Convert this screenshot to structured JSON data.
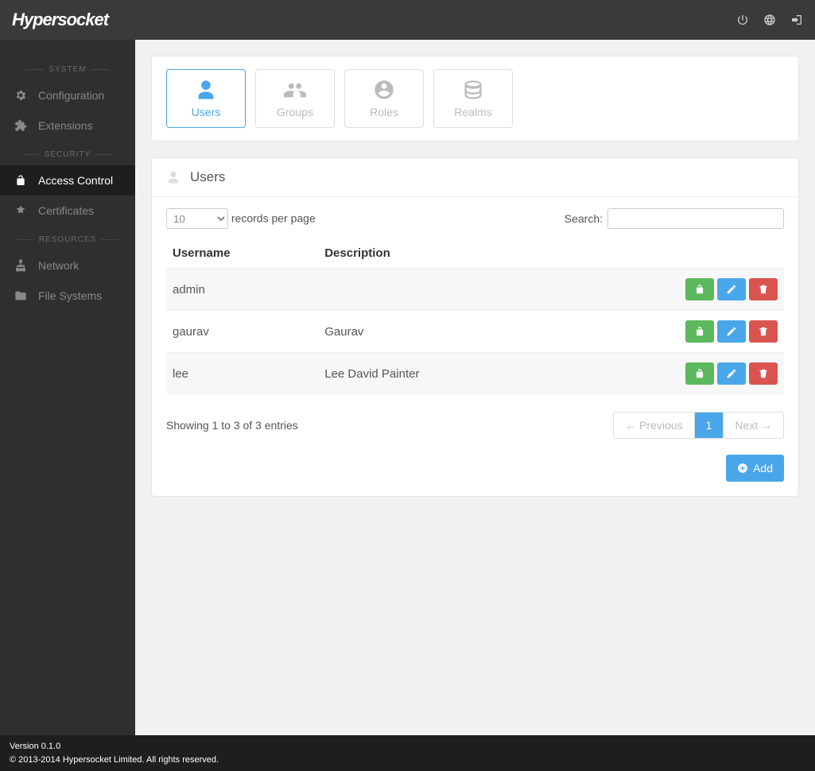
{
  "brand": "Hypersocket",
  "sidebar": {
    "sections": [
      {
        "label": "SYSTEM",
        "items": [
          {
            "id": "configuration",
            "label": "Configuration",
            "icon": "gear"
          },
          {
            "id": "extensions",
            "label": "Extensions",
            "icon": "puzzle"
          }
        ]
      },
      {
        "label": "SECURITY",
        "items": [
          {
            "id": "access-control",
            "label": "Access Control",
            "icon": "unlock",
            "active": true
          },
          {
            "id": "certificates",
            "label": "Certificates",
            "icon": "certificate"
          }
        ]
      },
      {
        "label": "RESOURCES",
        "items": [
          {
            "id": "network",
            "label": "Network",
            "icon": "sitemap"
          },
          {
            "id": "file-systems",
            "label": "File Systems",
            "icon": "folder"
          }
        ]
      }
    ]
  },
  "tabs": [
    {
      "id": "users",
      "label": "Users",
      "icon": "user",
      "active": true
    },
    {
      "id": "groups",
      "label": "Groups",
      "icon": "users"
    },
    {
      "id": "roles",
      "label": "Roles",
      "icon": "usercircle"
    },
    {
      "id": "realms",
      "label": "Realms",
      "icon": "database"
    }
  ],
  "panel": {
    "title": "Users",
    "page_size": "10",
    "records_per_page_label": "records per page",
    "search_label": "Search:",
    "search_value": "",
    "columns": {
      "c1": "Username",
      "c2": "Description"
    },
    "rows": [
      {
        "username": "admin",
        "description": ""
      },
      {
        "username": "gaurav",
        "description": "Gaurav"
      },
      {
        "username": "lee",
        "description": "Lee David Painter"
      }
    ],
    "info": "Showing 1 to 3 of 3 entries",
    "pager": {
      "prev": "← Previous",
      "page": "1",
      "next": "Next →"
    },
    "add_label": "Add"
  },
  "footer": {
    "version": "Version 0.1.0",
    "copyright": "© 2013-2014 Hypersocket Limited. All rights reserved."
  }
}
